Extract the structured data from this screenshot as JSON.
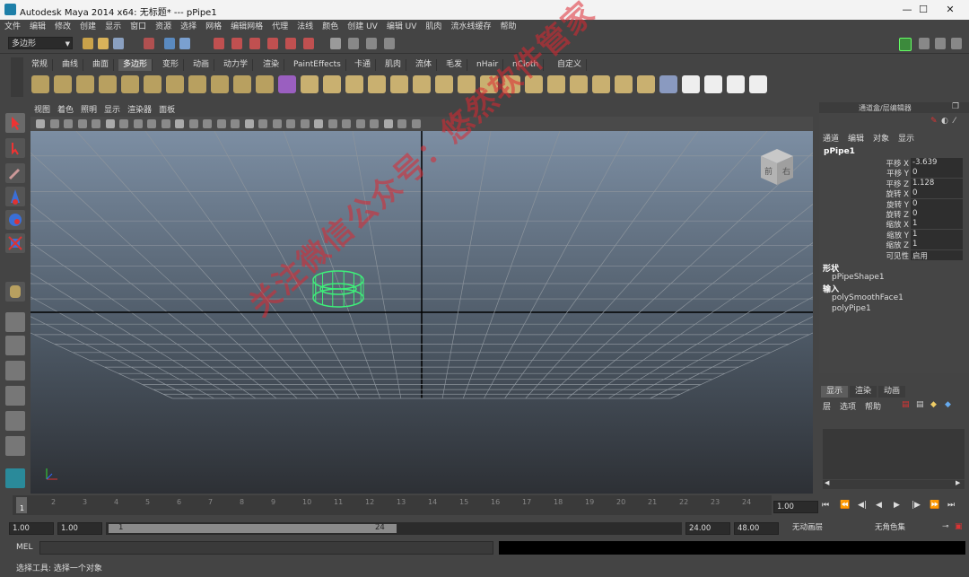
{
  "window": {
    "title": "Autodesk Maya 2014 x64: 无标题*   ---   pPipe1"
  },
  "menubar": [
    "文件",
    "编辑",
    "修改",
    "创建",
    "显示",
    "窗口",
    "资源",
    "选择",
    "网格",
    "编辑网格",
    "代理",
    "法线",
    "颜色",
    "创建 UV",
    "编辑 UV",
    "肌肉",
    "流水线缓存",
    "帮助"
  ],
  "toolbar": {
    "mode": "多边形"
  },
  "shelf_tabs": [
    "常规",
    "曲线",
    "曲面",
    "多边形",
    "变形",
    "动画",
    "动力学",
    "渲染",
    "PaintEffects",
    "卡通",
    "肌肉",
    "流体",
    "毛发",
    "nHair",
    "nCloth",
    "自定义"
  ],
  "shelf_active": "多边形",
  "viewport": {
    "menu": [
      "视图",
      "着色",
      "照明",
      "显示",
      "渲染器",
      "面板"
    ],
    "viewcube_labels": [
      "前",
      "右"
    ]
  },
  "channel_box": {
    "header": "通道盒/层编辑器",
    "menu": [
      "通道",
      "编辑",
      "对象",
      "显示"
    ],
    "object": "pPipe1",
    "channels": [
      {
        "label": "平移 X",
        "value": "-3.639"
      },
      {
        "label": "平移 Y",
        "value": "0"
      },
      {
        "label": "平移 Z",
        "value": "1.128"
      },
      {
        "label": "旋转 X",
        "value": "0"
      },
      {
        "label": "旋转 Y",
        "value": "0"
      },
      {
        "label": "旋转 Z",
        "value": "0"
      },
      {
        "label": "缩放 X",
        "value": "1"
      },
      {
        "label": "缩放 Y",
        "value": "1"
      },
      {
        "label": "缩放 Z",
        "value": "1"
      },
      {
        "label": "可见性",
        "value": "启用"
      }
    ],
    "shapes_header": "形状",
    "shape": "pPipeShape1",
    "inputs_header": "输入",
    "inputs": [
      "polySmoothFace1",
      "polyPipe1"
    ]
  },
  "layer_editor": {
    "tabs": [
      "显示",
      "渲染",
      "动画"
    ],
    "menu": [
      "层",
      "选项",
      "帮助"
    ]
  },
  "time_slider": {
    "ticks": [
      "1",
      "2",
      "3",
      "4",
      "5",
      "6",
      "7",
      "8",
      "9",
      "10",
      "11",
      "12",
      "13",
      "14",
      "15",
      "16",
      "17",
      "18",
      "19",
      "20",
      "21",
      "22",
      "23",
      "24"
    ],
    "current": "1",
    "current_time": "1.00"
  },
  "range": {
    "start": "1.00",
    "playback_start": "1.00",
    "range_start": "1",
    "range_end": "24",
    "playback_end": "24.00",
    "end": "48.00",
    "anim_layer": "无动画层",
    "char_set": "无角色集"
  },
  "mel": {
    "label": "MEL"
  },
  "help_line": "选择工具: 选择一个对象",
  "watermark": "关注微信公众号：悠然软件管家"
}
